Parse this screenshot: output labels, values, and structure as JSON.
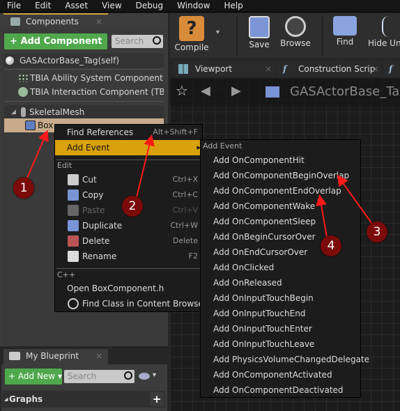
{
  "menubar": [
    "File",
    "Edit",
    "Asset",
    "View",
    "Debug",
    "Window",
    "Help"
  ],
  "components": {
    "tab": "Components",
    "add_button": "Add Component",
    "search_placeholder": "Search",
    "self": "GASActorBase_Tag(self)",
    "items": [
      "TBIA Ability System Component (TB",
      "TBIA Interaction Component (TBIA_"
    ],
    "skeletal": "SkeletalMesh",
    "box": "Box"
  },
  "toolbar": {
    "compile": "Compile",
    "save": "Save",
    "browse": "Browse",
    "find": "Find",
    "hide": "Hide Unr"
  },
  "doc_tabs": [
    "Viewport",
    "Construction Scrip"
  ],
  "breadcrumb": "GASActorBase_Tag",
  "context_menu": {
    "find_refs": "Find References",
    "find_refs_sc": "Alt+Shift+F",
    "add_event": "Add Event",
    "edit_header": "Edit",
    "edit_items": [
      {
        "label": "Cut",
        "sc": "Ctrl+X",
        "icon": "scissors-icon"
      },
      {
        "label": "Copy",
        "sc": "Ctrl+C",
        "icon": "copy-icon"
      },
      {
        "label": "Paste",
        "sc": "Ctrl+V",
        "icon": "paste-icon",
        "disabled": true
      },
      {
        "label": "Duplicate",
        "sc": "Ctrl+W",
        "icon": "duplicate-icon"
      },
      {
        "label": "Delete",
        "sc": "Delete",
        "icon": "delete-icon"
      },
      {
        "label": "Rename",
        "sc": "F2",
        "icon": "rename-icon"
      }
    ],
    "cpp_header": "C++",
    "open_h": "Open BoxComponent.h",
    "find_class": "Find Class in Content Browser"
  },
  "submenu": {
    "header": "Add Event",
    "items": [
      "Add OnComponentHit",
      "Add OnComponentBeginOverlap",
      "Add OnComponentEndOverlap",
      "Add OnComponentWake",
      "Add OnComponentSleep",
      "Add OnBeginCursorOver",
      "Add OnEndCursorOver",
      "Add OnClicked",
      "Add OnReleased",
      "Add OnInputTouchBegin",
      "Add OnInputTouchEnd",
      "Add OnInputTouchEnter",
      "Add OnInputTouchLeave",
      "Add PhysicsVolumeChangedDelegate",
      "Add OnComponentActivated",
      "Add OnComponentDeactivated"
    ]
  },
  "my_blueprint": {
    "tab": "My Blueprint",
    "add_new": "Add New",
    "search_placeholder": "Search",
    "graphs": "Graphs"
  },
  "markers": [
    "1",
    "2",
    "3",
    "4"
  ],
  "colors": {
    "accent": "#d9a10c",
    "green": "#4fa84c",
    "marker": "#7b0a0a",
    "arrow": "#ff1a1a",
    "selected": "#c8ab8a"
  }
}
